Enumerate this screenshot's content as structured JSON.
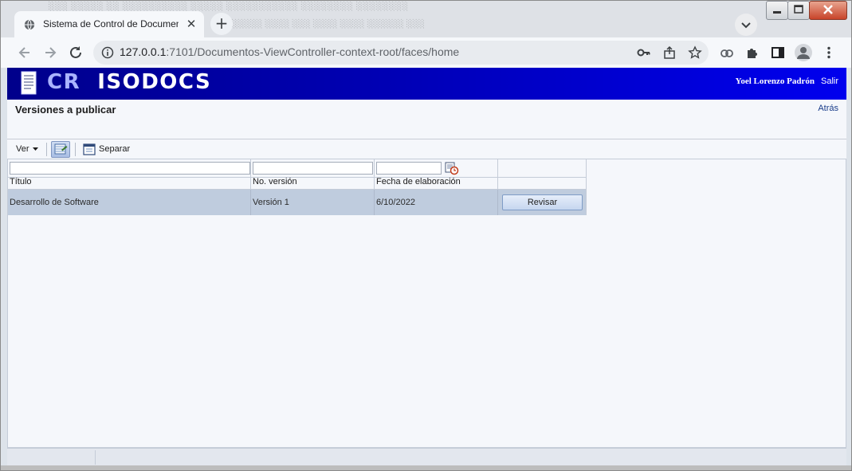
{
  "browser": {
    "tab_title": "Sistema de Control de Document",
    "tab_close": "✕",
    "new_tab": "+",
    "url_host": "127.0.0.1",
    "url_rest": ":7101/Documentos-ViewController-context-root/faces/home"
  },
  "header": {
    "brand_cr": "CR",
    "brand_name": "ISODOCS",
    "user_name": "Yoel Lorenzo Padrón",
    "logout_label": "Salir"
  },
  "page": {
    "title": "Versiones a publicar",
    "back_label": "Atrás"
  },
  "toolbar": {
    "view_menu_label": "Ver",
    "detach_label": "Separar"
  },
  "table": {
    "columns": [
      "Título",
      "No. versión",
      "Fecha de elaboración"
    ],
    "rows": [
      {
        "titulo": "Desarrollo de Software",
        "version": "Versión 1",
        "fecha": "6/10/2022",
        "action_label": "Revisar"
      }
    ]
  },
  "colors": {
    "banner_start": "#00008b",
    "banner_end": "#0000ee",
    "selected_row": "#bfccde"
  }
}
